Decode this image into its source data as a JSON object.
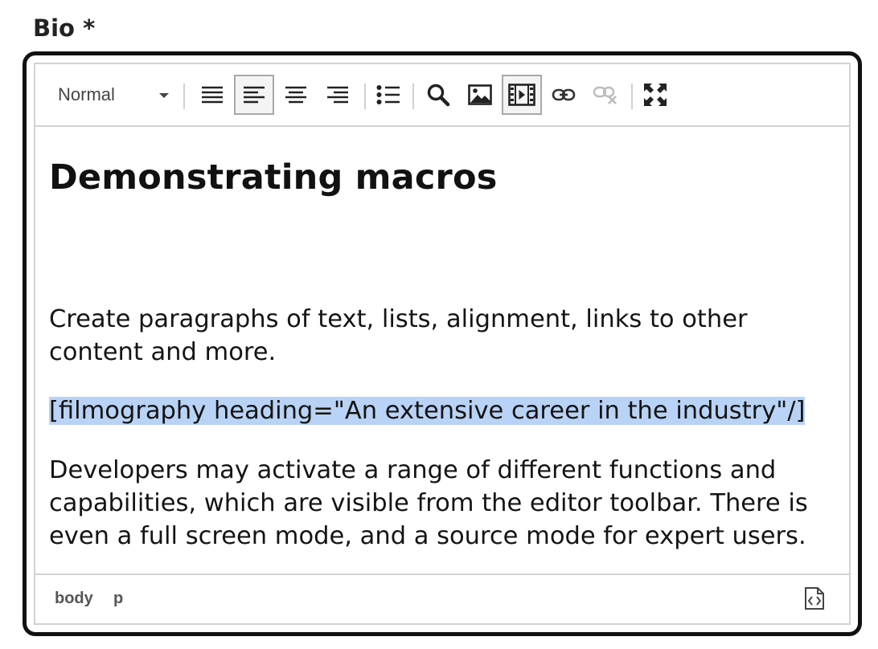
{
  "field": {
    "label": "Bio *"
  },
  "toolbar": {
    "format_value": "Normal",
    "buttons": [
      {
        "icon": "align-justify-icon",
        "active": false
      },
      {
        "icon": "align-left-icon",
        "active": true
      },
      {
        "icon": "align-center-icon",
        "active": false
      },
      {
        "icon": "align-right-icon",
        "active": false
      },
      {
        "icon": "bullet-list-icon",
        "active": false
      },
      {
        "icon": "search-icon",
        "active": false
      },
      {
        "icon": "image-icon",
        "active": false
      },
      {
        "icon": "media-icon",
        "active": true
      },
      {
        "icon": "link-icon",
        "active": false
      },
      {
        "icon": "unlink-icon",
        "active": false,
        "disabled": true
      },
      {
        "icon": "fullscreen-icon",
        "active": false
      }
    ]
  },
  "content": {
    "heading": "Demonstrating macros",
    "paragraphs": [
      "Create paragraphs of text, lists, alignment, links to other content and more.",
      "[filmography heading=\"An extensive career in the industry\"/]",
      "Developers may activate a range of different functions and capabilities, which are visible from the editor toolbar. There is even a full screen mode, and a source mode for expert users."
    ],
    "selection_color": "#b9d3f6"
  },
  "statusbar": {
    "path": [
      "body",
      "p"
    ],
    "source_icon": "source-code-icon"
  }
}
